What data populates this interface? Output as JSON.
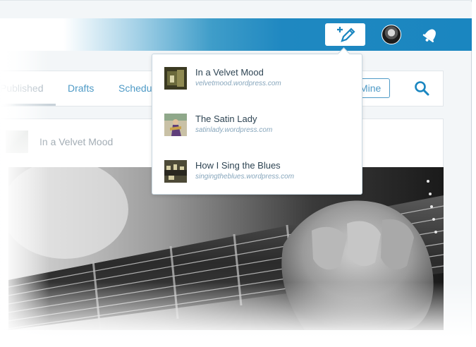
{
  "masterbar": {
    "write_icon": "write-post-icon",
    "avatar_icon": "user-avatar",
    "notifications_icon": "notifications-bell-icon",
    "accent": "#1a86c0"
  },
  "tabs": {
    "items": [
      {
        "label": "Published"
      },
      {
        "label": "Drafts"
      },
      {
        "label": "Scheduled"
      }
    ],
    "filter_label": "Mine",
    "search_icon": "search-icon"
  },
  "post": {
    "site_name": "In a Velvet Mood",
    "image": "guitar-photo"
  },
  "site_switcher": {
    "sites": [
      {
        "title": "In a Velvet Mood",
        "url": "velvetmood.wordpress.com"
      },
      {
        "title": "The Satin Lady",
        "url": "satinlady.wordpress.com"
      },
      {
        "title": "How I Sing the Blues",
        "url": "singingtheblues.wordpress.com"
      }
    ]
  }
}
